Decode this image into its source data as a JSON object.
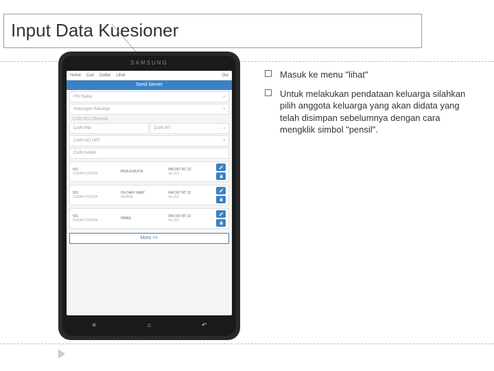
{
  "title": "Input Data Kuesioner",
  "phone": {
    "brand": "SAMSUNG",
    "topbar": {
      "home": "Home",
      "cari": "Cari",
      "daftar": "Daftar",
      "lihat": "Lihat",
      "out": "Out"
    },
    "bluebar": "Send Server",
    "form": {
      "pih": "PIh Status",
      "hub": "Hubungan Keluarga",
      "kel": "CARI KELURAHAN",
      "rw": "CARI RW",
      "rt": "CARI RT",
      "nourut": "CARI NO URT",
      "nama": "CARI NAMA"
    },
    "rows": [
      {
        "c1a": "501",
        "c1b": "SUDAH DIDATA",
        "c2a": "PERLA MIJITA",
        "c2b": "",
        "c3a": "RW 007 RT 13",
        "c3b": "No.351"
      },
      {
        "c1a": "501",
        "c1b": "SUDAH DIDATA",
        "c2a": "ITA DARI UMAT",
        "c2b": "ISKANE",
        "c3a": "RW 007 RT 13",
        "c3b": "No.351"
      },
      {
        "c1a": "501",
        "c1b": "SUDAH DIDATA",
        "c2a": "ISMAIL",
        "c2b": "",
        "c3a": "RW 007 RT 13",
        "c3b": "No.351"
      }
    ],
    "more": "More >>"
  },
  "bullets": [
    "Masuk ke menu \"lihat\"",
    "Untuk melakukan pendataan keluarga silahkan pilih anggota keluarga yang akan didata yang telah disimpan sebelumnya dengan cara mengklik simbol \"pensil\"."
  ]
}
